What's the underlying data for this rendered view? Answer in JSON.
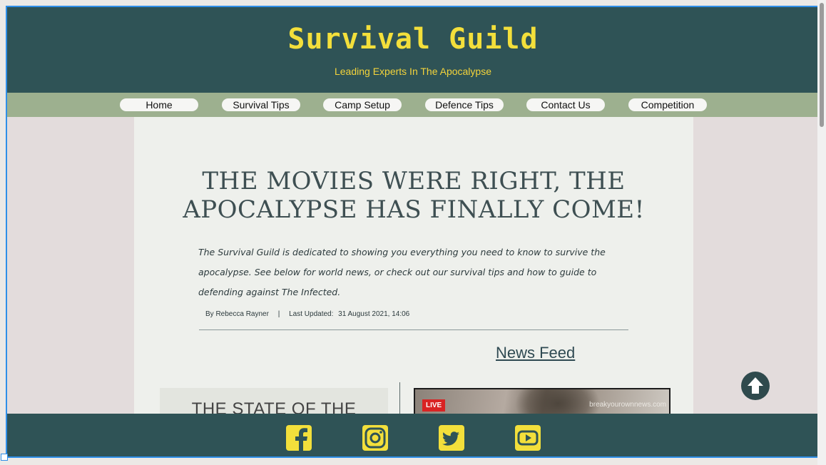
{
  "header": {
    "title": "Survival Guild",
    "tagline": "Leading Experts In The Apocalypse"
  },
  "nav": {
    "items": [
      "Home",
      "Survival Tips",
      "Camp Setup",
      "Defence Tips",
      "Contact Us",
      "Competition"
    ]
  },
  "main": {
    "headline": "THE MOVIES WERE RIGHT, THE APOCALYPSE HAS FINALLY COME!",
    "intro": "The Survival Guild is dedicated to showing you everything you need to know to survive the apocalypse. See below for world news, or check out our survival tips and how to guide to defending against The Infected.",
    "byline": {
      "author": "By Rebecca Rayner",
      "separator": "|",
      "updated_label": "Last Updated:",
      "updated_value": "31 August 2021, 14:06"
    },
    "news_feed_label": "News Feed",
    "state_title": "THE STATE OF THE WORLD",
    "video": {
      "live_label": "LIVE",
      "watermark": "breakyourownnews.com"
    }
  },
  "footer": {
    "social_icons": [
      "facebook-icon",
      "instagram-icon",
      "twitter-icon",
      "youtube-icon"
    ]
  },
  "colors": {
    "header_bg": "#2f5356",
    "title_yellow": "#f3df3b",
    "nav_bg": "#9db08f",
    "content_bg": "#eef0ec",
    "page_bg": "#e3dcdc",
    "live_red": "#d92323"
  }
}
